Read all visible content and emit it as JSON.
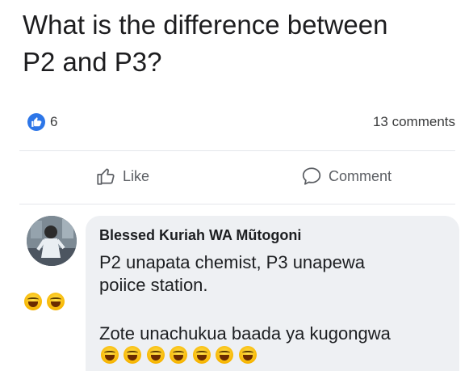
{
  "post": {
    "text_line1": "What is the difference between",
    "text_line2": "P2 and P3?"
  },
  "stats": {
    "like_count": "6",
    "comments_count": "13 comments"
  },
  "actions": {
    "like_label": "Like",
    "comment_label": "Comment"
  },
  "comment": {
    "author": "Blessed Kuriah WA Mũtogoni",
    "line1": "P2 unapata chemist, P3 unapewa",
    "line2": "poiice station.",
    "line3": "Zote unachukua baada ya kugongwa",
    "laughing_emoji_count": 7
  },
  "left_reactions": {
    "laughing_emoji_count": 2
  },
  "colors": {
    "like_badge": "#2d76e8",
    "bubble_bg": "#eef0f3",
    "muted_text": "#5b5e63"
  },
  "icons": [
    "like-badge-icon",
    "thumbs-up-icon",
    "comment-bubble-icon",
    "laughing-emoji-icon"
  ]
}
